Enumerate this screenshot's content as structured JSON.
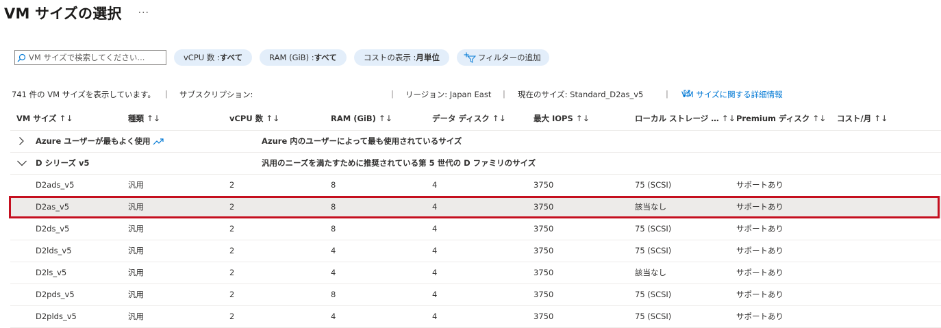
{
  "header": {
    "title": "VM サイズの選択",
    "more": "···"
  },
  "filters": {
    "search_placeholder": "VM サイズで検索してください...",
    "pills": [
      {
        "label": "vCPU 数 : ",
        "value": "すべて"
      },
      {
        "label": "RAM (GiB) : ",
        "value": "すべて"
      },
      {
        "label": "コストの表示 : ",
        "value": "月単位"
      }
    ],
    "add_filter": "フィルターの追加"
  },
  "info": {
    "count": "741 件の VM サイズを表示しています。",
    "subscription": "サブスクリプション:",
    "region": "リージョン: Japan East",
    "current_size": "現在のサイズ: Standard_D2as_v5",
    "link": "VM サイズに関する詳細情報"
  },
  "columns": [
    "VM サイズ",
    "種類",
    "vCPU 数",
    "RAM (GiB)",
    "データ ディスク",
    "最大 IOPS",
    "ローカル ストレージ …",
    "Premium ディスク",
    "コスト/月"
  ],
  "groups": [
    {
      "name": "Azure ユーザーが最もよく使用",
      "description": "Azure 内のユーザーによって最も使用されているサイズ",
      "expanded": false
    },
    {
      "name": "D シリーズ v5",
      "description": "汎用のニーズを満たすために推奨されている第 5 世代の D ファミリのサイズ",
      "expanded": true
    }
  ],
  "rows": [
    {
      "size": "D2ads_v5",
      "type": "汎用",
      "vcpu": "2",
      "ram": "8",
      "disks": "4",
      "iops": "3750",
      "storage": "75 (SCSI)",
      "premium": "サポートあり",
      "cost": ""
    },
    {
      "size": "D2as_v5",
      "type": "汎用",
      "vcpu": "2",
      "ram": "8",
      "disks": "4",
      "iops": "3750",
      "storage": "該当なし",
      "premium": "サポートあり",
      "cost": ""
    },
    {
      "size": "D2ds_v5",
      "type": "汎用",
      "vcpu": "2",
      "ram": "8",
      "disks": "4",
      "iops": "3750",
      "storage": "75 (SCSI)",
      "premium": "サポートあり",
      "cost": ""
    },
    {
      "size": "D2lds_v5",
      "type": "汎用",
      "vcpu": "2",
      "ram": "4",
      "disks": "4",
      "iops": "3750",
      "storage": "75 (SCSI)",
      "premium": "サポートあり",
      "cost": ""
    },
    {
      "size": "D2ls_v5",
      "type": "汎用",
      "vcpu": "2",
      "ram": "4",
      "disks": "4",
      "iops": "3750",
      "storage": "該当なし",
      "premium": "サポートあり",
      "cost": ""
    },
    {
      "size": "D2pds_v5",
      "type": "汎用",
      "vcpu": "2",
      "ram": "8",
      "disks": "4",
      "iops": "3750",
      "storage": "75 (SCSI)",
      "premium": "サポートあり",
      "cost": ""
    },
    {
      "size": "D2plds_v5",
      "type": "汎用",
      "vcpu": "2",
      "ram": "4",
      "disks": "4",
      "iops": "3750",
      "storage": "75 (SCSI)",
      "premium": "サポートあり",
      "cost": ""
    }
  ],
  "selected_row": "D2as_v5",
  "icons": {
    "search": "search-icon",
    "add_filter": "filter-add-icon",
    "external_link": "external-link-icon",
    "trend": "trending-icon",
    "chevron_right": "chevron-right-icon",
    "chevron_down": "chevron-down-icon",
    "sort": "sort-icon"
  },
  "colors": {
    "accent": "#0078d4",
    "pill_bg": "#e3eefa",
    "selection_border": "#c50f1f",
    "selected_row_bg": "#edebe9"
  }
}
